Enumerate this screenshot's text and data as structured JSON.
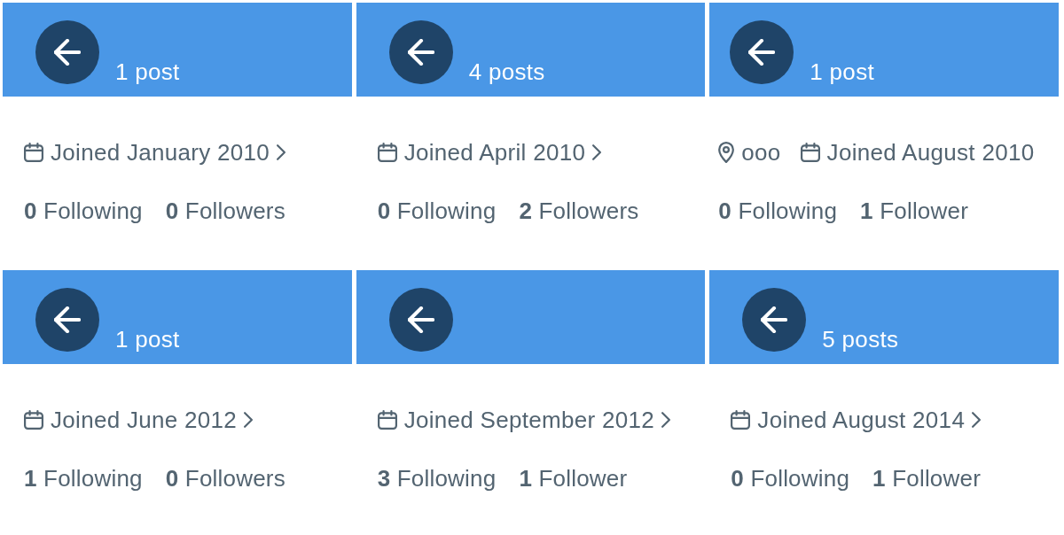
{
  "panels": [
    {
      "header": {
        "posts": "1 post"
      },
      "meta": [
        {
          "kind": "joined",
          "text": "Joined January 2010",
          "chevron": true
        }
      ],
      "stats": [
        "**0** Following",
        "**0** Followers"
      ]
    },
    {
      "header": {
        "posts": "4 posts"
      },
      "meta": [
        {
          "kind": "joined",
          "text": "Joined April 2010",
          "chevron": true
        }
      ],
      "stats": [
        "**0** Following",
        "**2** Followers"
      ]
    },
    {
      "header": {
        "posts": "1 post"
      },
      "meta": [
        {
          "kind": "location",
          "text": "ooo"
        },
        {
          "kind": "joined",
          "text": "Joined August 2010",
          "chevron": false
        }
      ],
      "stats": [
        "**0** Following",
        "**1** Follower"
      ]
    },
    {
      "header": {
        "posts": "1 post"
      },
      "meta": [
        {
          "kind": "joined",
          "text": "Joined June 2012",
          "chevron": true
        }
      ],
      "stats": [
        "**1** Following",
        "**0** Followers"
      ]
    },
    {
      "meta": [
        {
          "kind": "joined",
          "text": "Joined September 2012",
          "chevron": true
        }
      ],
      "stats": [
        "**3** Following",
        "**1** Follower"
      ]
    },
    {
      "header": {
        "posts": "5 posts"
      },
      "meta": [
        {
          "kind": "joined",
          "text": "Joined August 2014",
          "chevron": true
        }
      ],
      "stats": [
        "**0** Following",
        "**1** Follower"
      ]
    }
  ]
}
